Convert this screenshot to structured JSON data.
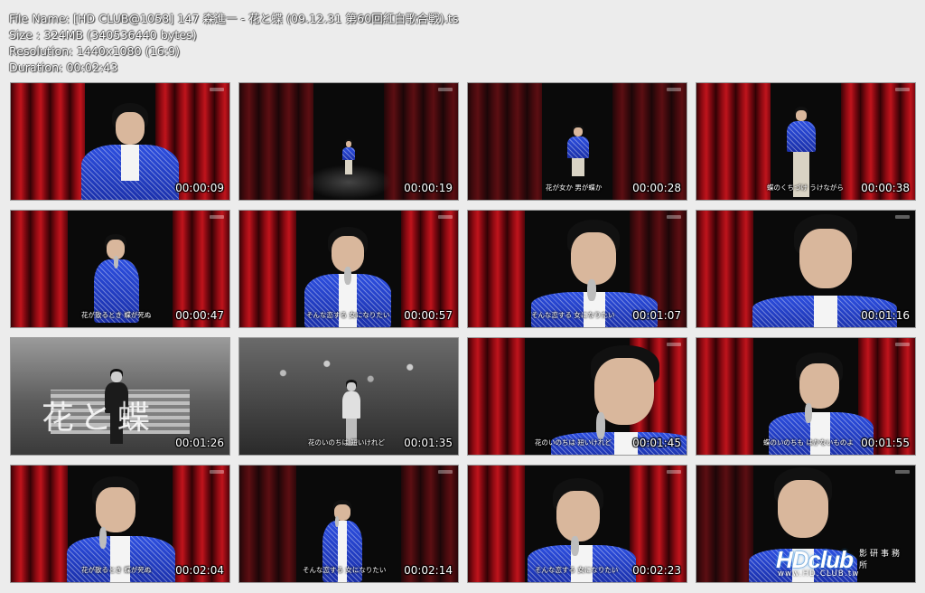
{
  "file_info": {
    "file_name": "File Name: [HD CLUB@1058] 147 森進一 - 花と蝶 (09.12.31 第60回紅白歌合戦).ts",
    "size": "Size : 324MB (340536440 bytes)",
    "resolution": "Resolution: 1440x1080 (16:9)",
    "duration": "Duration: 00:02:43"
  },
  "thumbnails": [
    {
      "timestamp": "00:00:09",
      "subtitle": ""
    },
    {
      "timestamp": "00:00:19",
      "subtitle": ""
    },
    {
      "timestamp": "00:00:28",
      "subtitle": "花が女か 男が蝶か"
    },
    {
      "timestamp": "00:00:38",
      "subtitle": "蝶のくちづけ うけながら"
    },
    {
      "timestamp": "00:00:47",
      "subtitle": "花が散るとき 蝶が死ぬ"
    },
    {
      "timestamp": "00:00:57",
      "subtitle": "そんな恋する 女になりたい"
    },
    {
      "timestamp": "00:01:07",
      "subtitle": "そんな恋する 女になりたい"
    },
    {
      "timestamp": "00:01:16",
      "subtitle": ""
    },
    {
      "timestamp": "00:01:26",
      "subtitle": ""
    },
    {
      "timestamp": "00:01:35",
      "subtitle": "花のいのちは 短いけれど"
    },
    {
      "timestamp": "00:01:45",
      "subtitle": "花のいのちは 短いけれど"
    },
    {
      "timestamp": "00:01:55",
      "subtitle": "蝶のいのちも はかないものよ"
    },
    {
      "timestamp": "00:02:04",
      "subtitle": "花が散るとき 蝶が死ぬ"
    },
    {
      "timestamp": "00:02:14",
      "subtitle": "そんな恋する 女になりたい"
    },
    {
      "timestamp": "00:02:23",
      "subtitle": "そんな恋する 女になりたい"
    },
    {
      "timestamp": "",
      "subtitle": ""
    }
  ],
  "bw_title": "花と蝶",
  "watermark": {
    "brand": "HDclub",
    "kanji": "影研事務所",
    "url": "www.HD.CLUB.tw"
  }
}
